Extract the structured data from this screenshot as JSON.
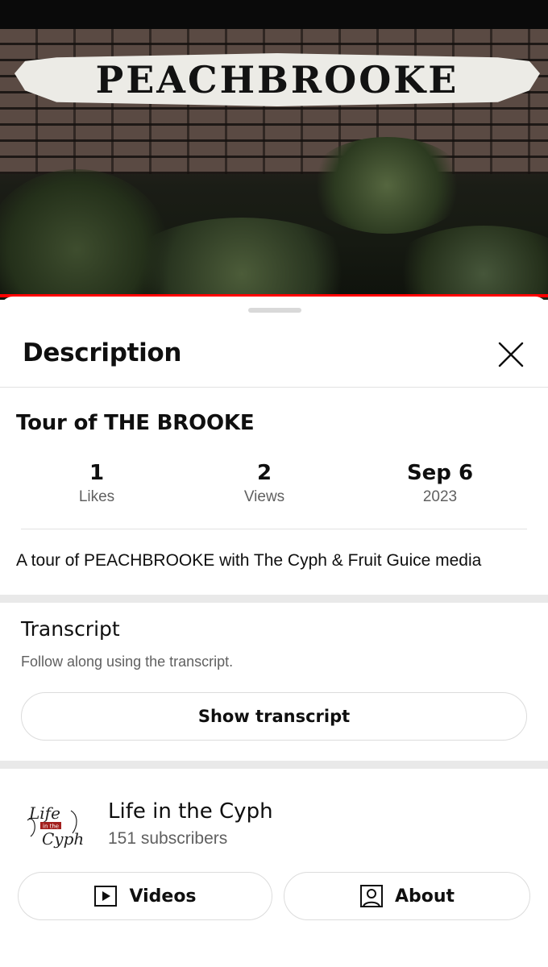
{
  "video": {
    "sign_text": "PEACHBROOKE",
    "progress_percent": 100
  },
  "sheet": {
    "title": "Description",
    "close_icon": "close-icon"
  },
  "details": {
    "title": "Tour of THE BROOKE",
    "stats": [
      {
        "value": "1",
        "label": "Likes"
      },
      {
        "value": "2",
        "label": "Views"
      },
      {
        "value": "Sep 6",
        "label": "2023"
      }
    ],
    "description": "A tour of PEACHBROOKE with The Cyph & Fruit Guice media"
  },
  "transcript": {
    "title": "Transcript",
    "subtitle": "Follow along using the transcript.",
    "button_label": "Show transcript"
  },
  "channel": {
    "name": "Life in the Cyph",
    "subscribers": "151 subscribers",
    "avatar_text": "Life in the Cyph",
    "videos_label": "Videos",
    "about_label": "About",
    "videos_icon": "play-box-icon",
    "about_icon": "person-box-icon"
  },
  "colors": {
    "accent": "#ff0000",
    "text_primary": "#0f0f0f",
    "text_secondary": "#606060",
    "divider": "#e2e2e2"
  }
}
